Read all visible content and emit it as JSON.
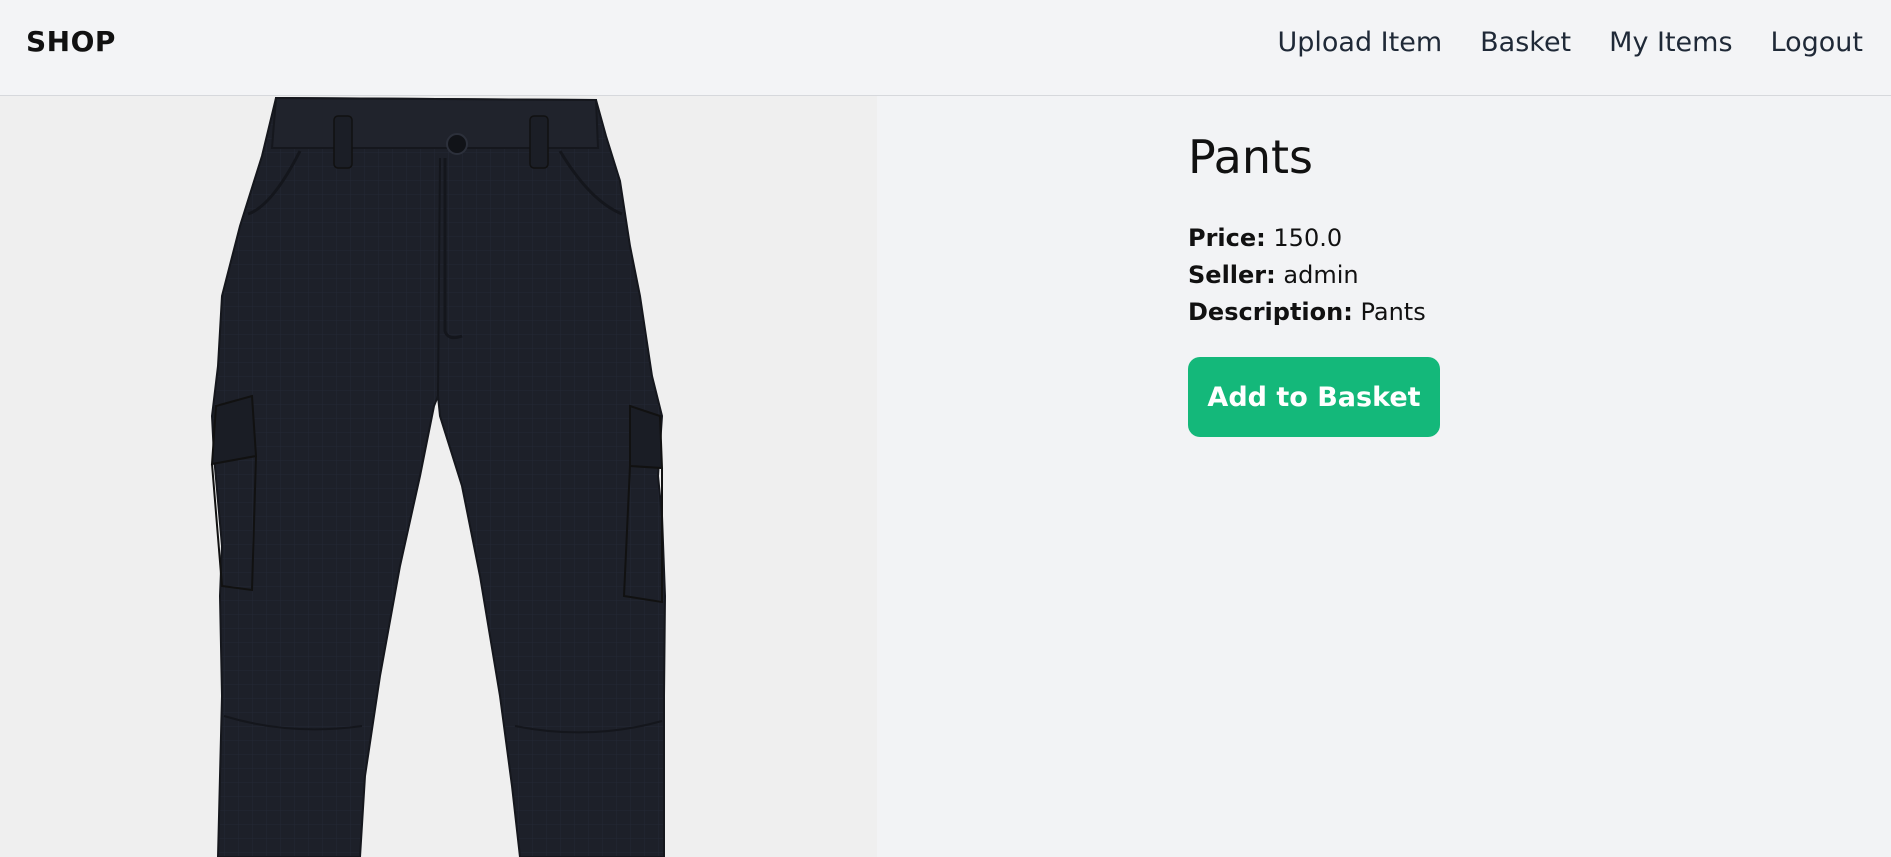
{
  "navbar": {
    "brand": "SHOP",
    "links": [
      "Upload Item",
      "Basket",
      "My Items",
      "Logout"
    ]
  },
  "product": {
    "title": "Pants",
    "price_label": "Price:",
    "price_value": "150.0",
    "seller_label": "Seller:",
    "seller_value": "admin",
    "description_label": "Description:",
    "description_value": "Pants",
    "image_alt": "pants-image"
  },
  "actions": {
    "add_to_basket": "Add to Basket"
  },
  "colors": {
    "accent": "#14b87a",
    "background": "#f2f3f5",
    "pants": "#1c1f27"
  }
}
